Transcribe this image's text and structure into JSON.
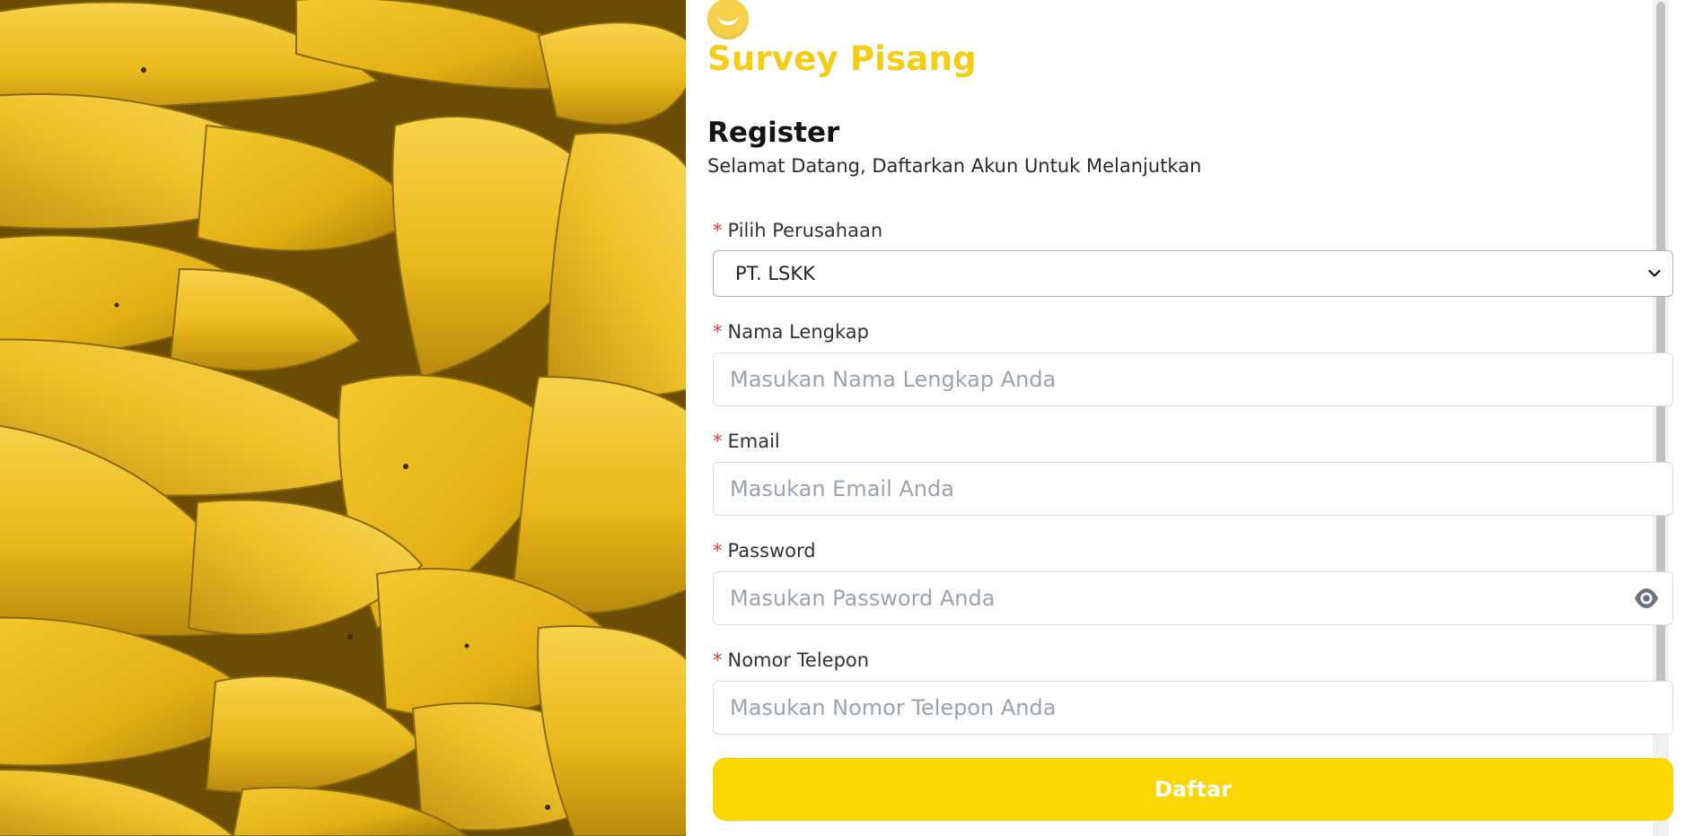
{
  "brand": {
    "logo_icon": "smile-logo-icon",
    "name": "Survey Pisang",
    "accent_color": "#f5cd12"
  },
  "header": {
    "title": "Register",
    "subtitle": "Selamat Datang, Daftarkan Akun Untuk Melanjutkan"
  },
  "form": {
    "required_marker": "*",
    "company": {
      "label": "Pilih Perusahaan",
      "selected": "PT. LSKK"
    },
    "full_name": {
      "label": "Nama Lengkap",
      "placeholder": "Masukan Nama Lengkap Anda",
      "value": ""
    },
    "email": {
      "label": "Email",
      "placeholder": "Masukan Email Anda",
      "value": ""
    },
    "password": {
      "label": "Password",
      "placeholder": "Masukan Password Anda",
      "value": "",
      "toggle_icon": "eye-icon"
    },
    "phone": {
      "label": "Nomor Telepon",
      "placeholder": "Masukan Nomor Telepon Anda",
      "value": ""
    },
    "submit_label": "Daftar",
    "submit_color": "#fdd600"
  },
  "hero": {
    "image": "bananas-photo"
  }
}
